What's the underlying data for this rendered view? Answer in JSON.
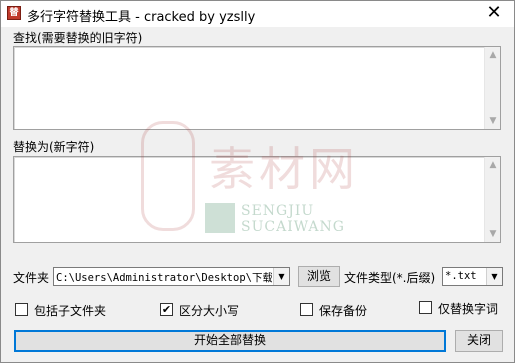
{
  "window": {
    "title": "多行字符替换工具 - cracked by yzslly",
    "close_symbol": "✕",
    "icon_glyph": "替"
  },
  "find": {
    "label": "查找(需要替换的旧字符)",
    "value": ""
  },
  "replace": {
    "label": "替换为(新字符)",
    "value": ""
  },
  "scroll": {
    "up": "▲",
    "down": "▼"
  },
  "folder": {
    "label": "文件夹",
    "path": "C:\\Users\\Administrator\\Desktop\\下载\\",
    "browse_label": "浏览"
  },
  "filetype": {
    "label": "文件类型(*.后缀)",
    "value": "*.txt"
  },
  "dropdown_arrow": "▼",
  "options": [
    {
      "label": "包括子文件夹",
      "checked": false
    },
    {
      "label": "区分大小写",
      "checked": true
    },
    {
      "label": "保存备份",
      "checked": false
    },
    {
      "label": "仅替换字词",
      "checked": false
    }
  ],
  "check_mark": "✔",
  "actions": {
    "start_label": "开始全部替换",
    "close_label": "关闭"
  },
  "watermark": {
    "cn": "素材网",
    "en_line1": "SENGJIU",
    "en_line2": "SUCAIWANG"
  }
}
